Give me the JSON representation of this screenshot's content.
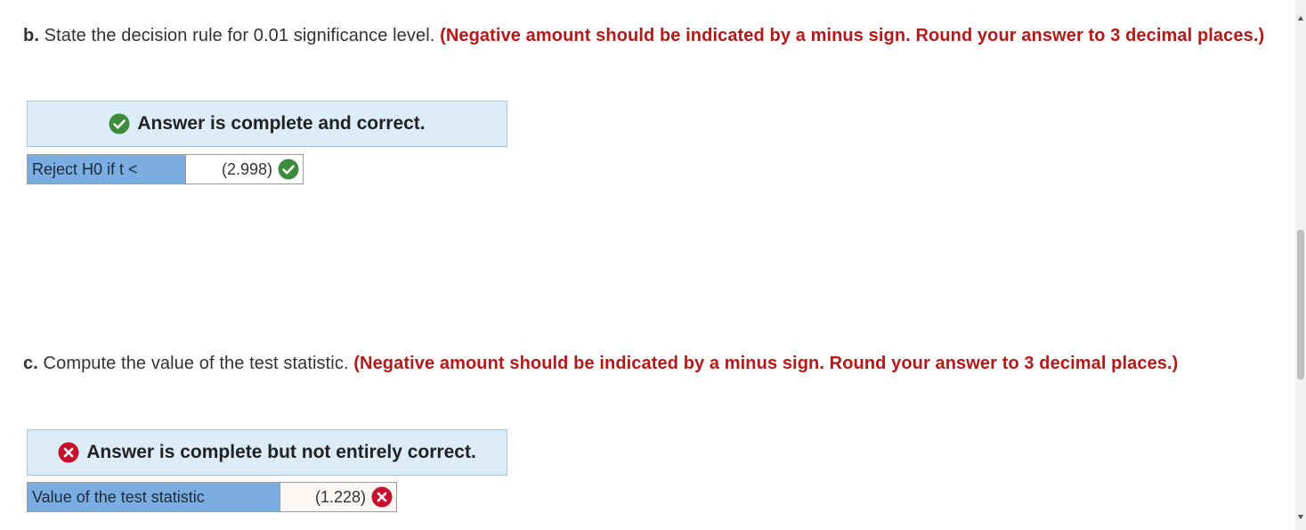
{
  "part_b": {
    "letter": "b.",
    "prompt": " State the decision rule for 0.01 significance level. ",
    "instruction": "(Negative amount should be indicated by a minus sign. Round your answer to 3 decimal places.)",
    "status_text": "Answer is complete and correct.",
    "status_icon": "check-circle-icon",
    "row_label": "Reject H0 if t <",
    "row_value": "(2.998)",
    "row_icon": "check-circle-icon",
    "status_color": "#3d8b3d"
  },
  "part_c": {
    "letter": "c.",
    "prompt": " Compute the value of the test statistic. ",
    "instruction": "(Negative amount should be indicated by a minus sign. Round your answer to 3 decimal places.)",
    "status_text": "Answer is complete but not entirely correct.",
    "status_icon": "x-circle-icon",
    "row_label": "Value of the test statistic",
    "row_value": "(1.228)",
    "row_icon": "x-circle-icon",
    "status_color": "#c8102e"
  },
  "colors": {
    "instruction_red": "#b21a1a",
    "banner_bg": "#dcecf8",
    "label_bg": "#7aaee3"
  }
}
